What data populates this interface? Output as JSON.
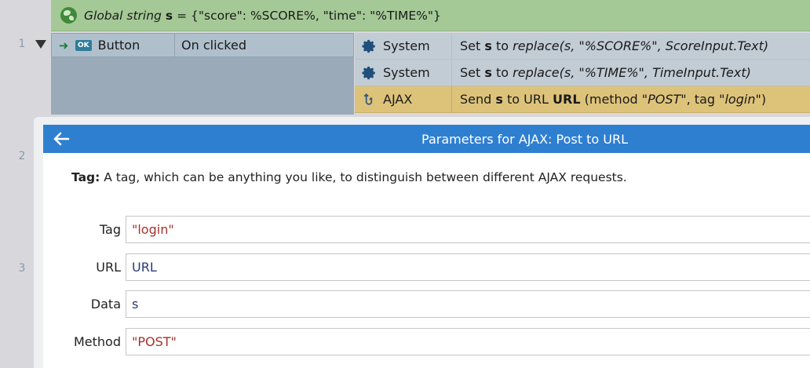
{
  "line_numbers": [
    "1",
    "2",
    "3"
  ],
  "global_var": {
    "prefix": "Global string",
    "name": "s",
    "value": "= {\"score\": %SCORE%, \"time\": \"%TIME%\"}"
  },
  "event": {
    "ok_label": "OK",
    "object": "Button",
    "condition": "On clicked"
  },
  "actions": [
    {
      "object": "System",
      "pre": "Set",
      "var": "s",
      "mid": "to",
      "expr": "replace(s, \"%SCORE%\", ScoreInput.Text)"
    },
    {
      "object": "System",
      "pre": "Set",
      "var": "s",
      "mid": "to",
      "expr": "replace(s, \"%TIME%\", TimeInput.Text)"
    },
    {
      "object": "AJAX",
      "pre": "Send",
      "var": "s",
      "mid": "to URL",
      "url": "URL",
      "method_open": "(method",
      "method": "\"POST\"",
      "tag_sep": ", tag",
      "tag": "\"login\"",
      "close": ")"
    }
  ],
  "dialog": {
    "title": "Parameters for AJAX: Post to URL",
    "desc_label": "Tag:",
    "desc_text": "A tag, which can be anything you like, to distinguish between different AJAX requests.",
    "fields": [
      {
        "label": "Tag",
        "value": "\"login\""
      },
      {
        "label": "URL",
        "value": "URL"
      },
      {
        "label": "Data",
        "value": "s"
      },
      {
        "label": "Method",
        "value": "\"POST\""
      }
    ]
  },
  "colors": {
    "global_bg": "#a4c996",
    "ajax_row_bg": "#ddc37a",
    "dialog_title_bg": "#2f7fd1",
    "string_color": "#a5322e"
  }
}
